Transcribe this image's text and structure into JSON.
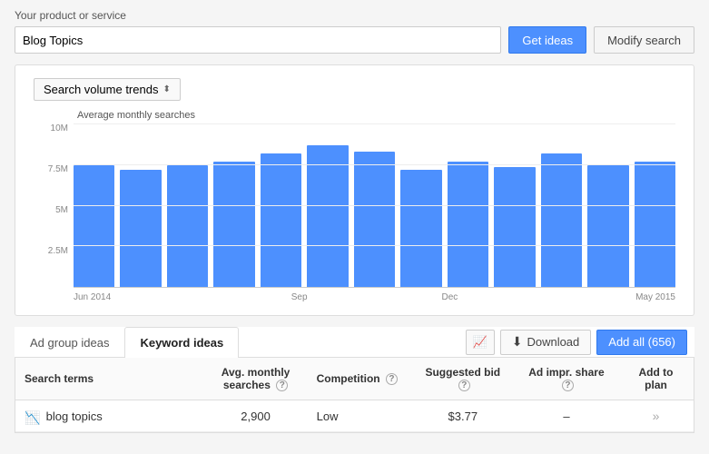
{
  "top": {
    "product_label": "Your product or service",
    "search_value": "Blog Topics",
    "get_ideas_label": "Get ideas",
    "modify_search_label": "Modify search"
  },
  "chart": {
    "dropdown_label": "Search volume trends",
    "y_axis_label": "Average monthly searches",
    "y_ticks": [
      "10M",
      "7.5M",
      "5M",
      "2.5M",
      ""
    ],
    "x_labels": [
      {
        "label": "Jun 2014",
        "position": 0
      },
      {
        "label": "Sep",
        "position": 3
      },
      {
        "label": "Dec",
        "position": 6
      },
      {
        "label": "May 2015",
        "position": 10
      }
    ],
    "bars": [
      75,
      72,
      75,
      77,
      82,
      87,
      83,
      72,
      77,
      74,
      82,
      75,
      77
    ]
  },
  "tabs": {
    "tab1_label": "Ad group ideas",
    "tab2_label": "Keyword ideas",
    "download_label": "Download",
    "add_all_label": "Add all (656)"
  },
  "table": {
    "headers": {
      "search_terms": "Search terms",
      "avg_monthly": "Avg. monthly searches",
      "competition": "Competition",
      "suggested_bid": "Suggested bid",
      "ad_impr_share": "Ad impr. share",
      "add_to_plan": "Add to plan"
    },
    "rows": [
      {
        "term": "blog topics",
        "avg": "2,900",
        "competition": "Low",
        "suggested_bid": "$3.77",
        "ad_impr_share": "–"
      }
    ]
  }
}
